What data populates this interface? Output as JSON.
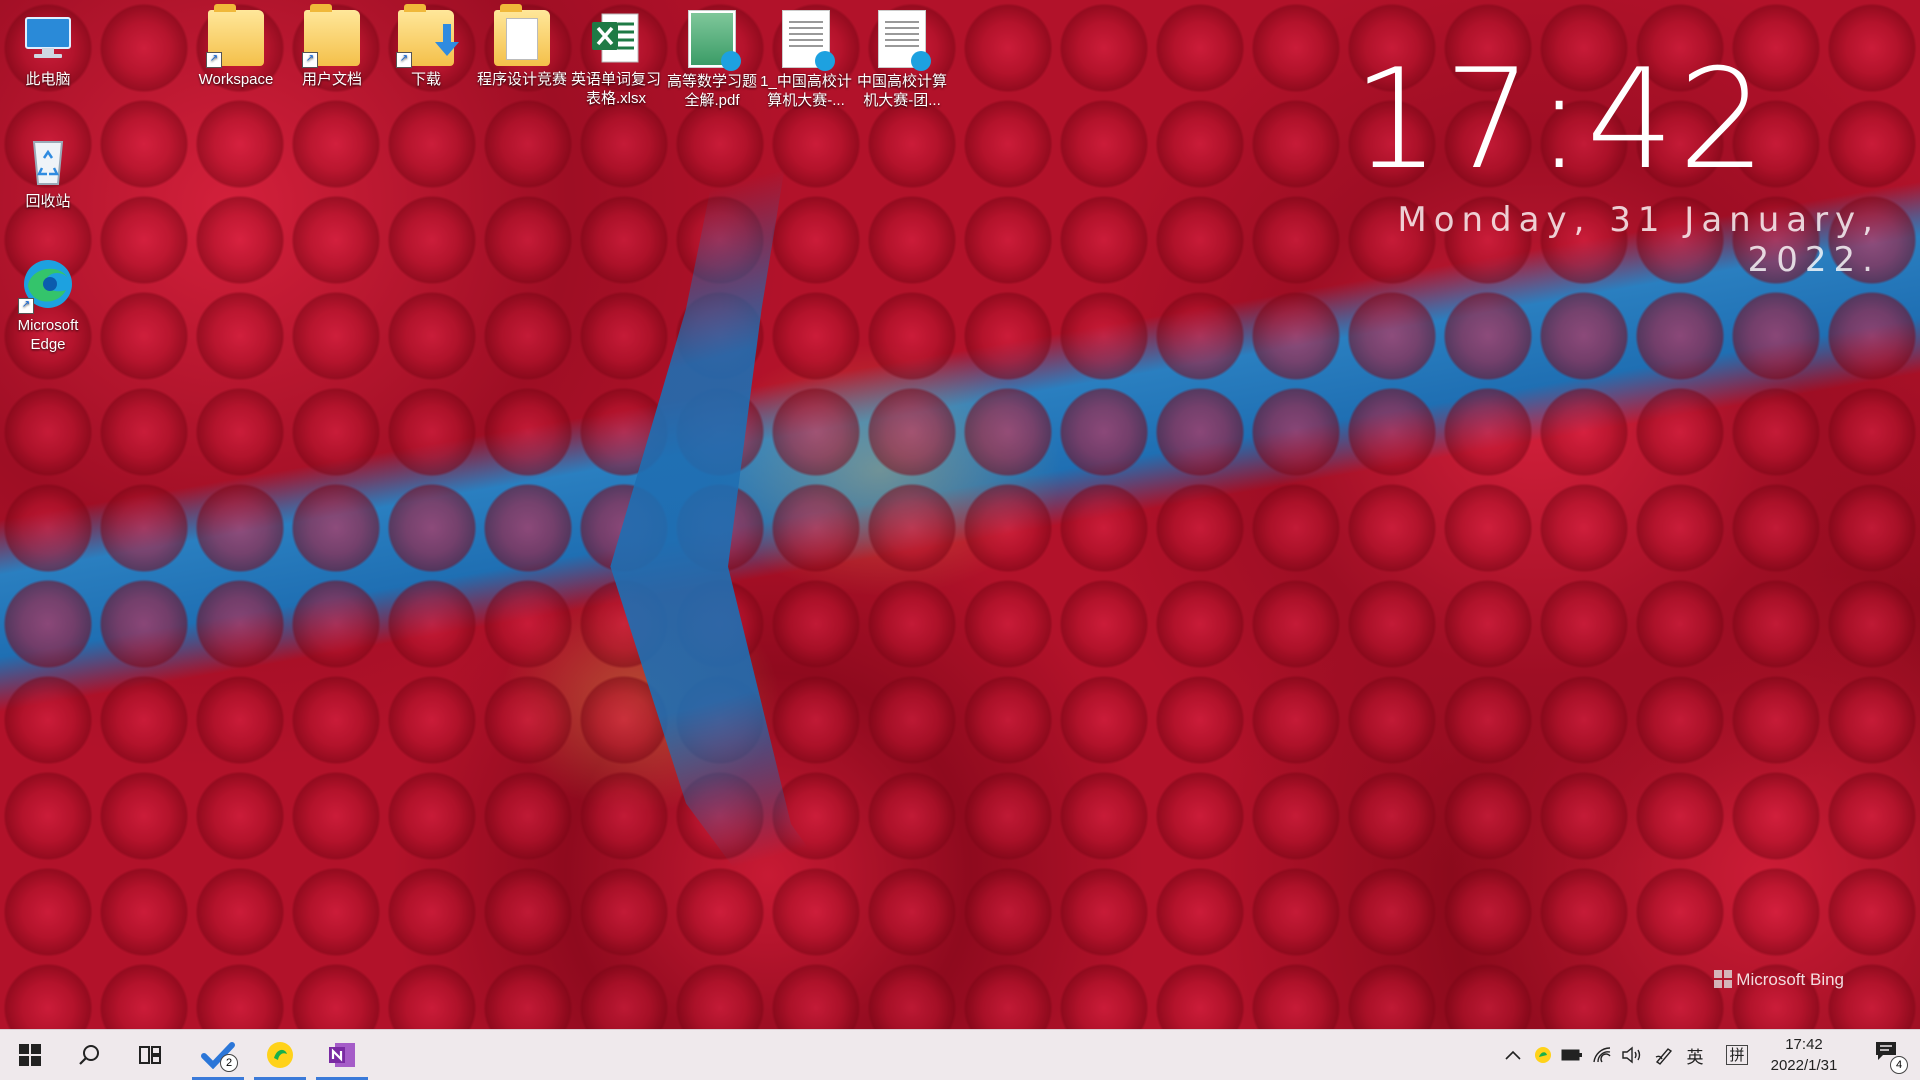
{
  "desktop_icons": [
    {
      "label": "此电脑",
      "icon": "this-pc-icon"
    },
    {
      "label": "回收站",
      "icon": "recycle-bin-icon"
    },
    {
      "label": "Microsoft Edge",
      "icon": "edge-icon"
    },
    {
      "label": "Workspace",
      "icon": "folder-icon"
    },
    {
      "label": "用户文档",
      "icon": "folder-icon"
    },
    {
      "label": "下载",
      "icon": "downloads-folder-icon"
    },
    {
      "label": "程序设计竞赛",
      "icon": "folder-icon"
    },
    {
      "label": "英语单词复习表格.xlsx",
      "icon": "excel-icon"
    },
    {
      "label": "高等数学习题全解.pdf",
      "icon": "pdf-icon"
    },
    {
      "label": "1_中国高校计算机大赛-...",
      "icon": "pdf-icon"
    },
    {
      "label": "中国高校计算机大赛-团...",
      "icon": "pdf-icon"
    }
  ],
  "clock_widget": {
    "time": "17:42",
    "date": "Monday, 31 January, 2022."
  },
  "watermark": "Microsoft Bing",
  "taskbar": {
    "start_icon": "windows-start-icon",
    "search_icon": "search-icon",
    "task_view_icon": "task-view-icon",
    "apps": [
      {
        "name": "todo-app",
        "badge": "2"
      },
      {
        "name": "music-app",
        "badge": ""
      },
      {
        "name": "onenote-app",
        "badge": ""
      }
    ],
    "tray": {
      "ime_lang": "英",
      "ime_mode": "拼",
      "time": "17:42",
      "date": "2022/1/31",
      "notification_count": "4"
    }
  },
  "colors": {
    "taskbar_bg": "#efe9ec",
    "accent": "#3a7ad9"
  }
}
